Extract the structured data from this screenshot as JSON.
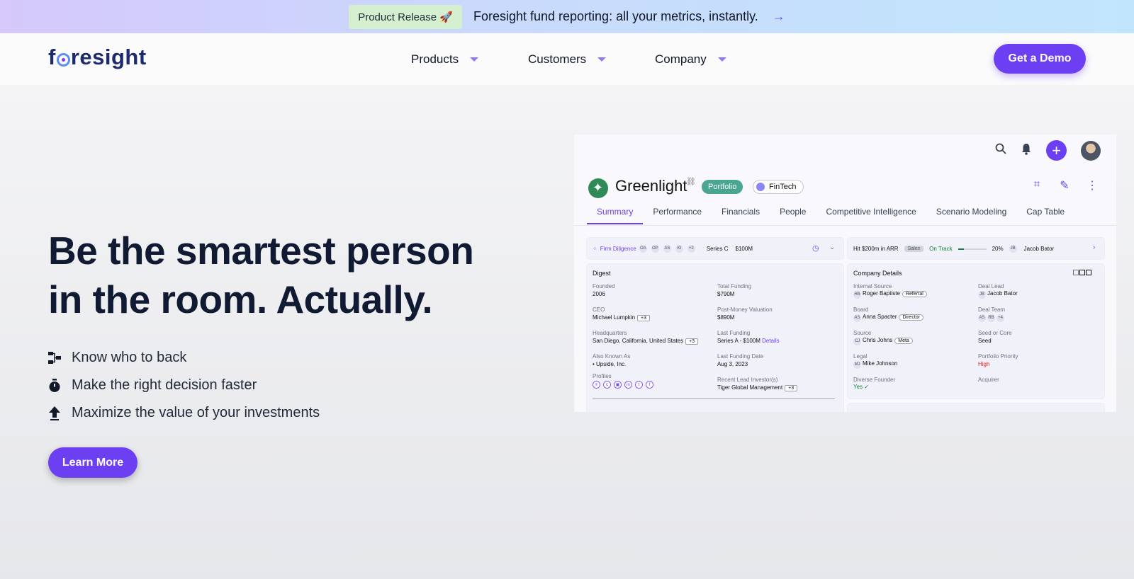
{
  "announcement": {
    "pill": "Product Release 🚀",
    "message": "Foresight fund reporting: all your metrics, instantly.",
    "arrow": "→"
  },
  "nav": {
    "logo": "foresight",
    "items": [
      {
        "label": "Products"
      },
      {
        "label": "Customers"
      },
      {
        "label": "Company"
      }
    ],
    "cta": "Get a Demo"
  },
  "hero": {
    "title_line1": "Be the smartest person",
    "title_line2": "in the room. Actually.",
    "features": [
      {
        "icon": "decision-tree-icon",
        "label": "Know who to back"
      },
      {
        "icon": "stopwatch-icon",
        "label": "Make the right decision faster"
      },
      {
        "icon": "arrow-up-icon",
        "label": "Maximize the value of your investments"
      }
    ],
    "cta": "Learn More"
  },
  "mockup": {
    "company": "Greenlight",
    "tags": {
      "portfolio": "Portfolio",
      "sector": "FinTech"
    },
    "tabs": [
      "Summary",
      "Performance",
      "Financials",
      "People",
      "Competitive Intelligence",
      "Scenario Modeling",
      "Cap Table"
    ],
    "active_tab": "Summary",
    "status_bar_left": {
      "label": "Firm Diligence",
      "initials": [
        "OA",
        "OP",
        "AS",
        "KI"
      ],
      "more": "+2",
      "series": "Series C",
      "amount": "$100M"
    },
    "status_bar_right": {
      "goal": "Hit $200m in ARR",
      "team": "Sales",
      "status": "On Track",
      "progress_percent": 20,
      "progress_label": "20%",
      "owner": "Jacob Bator",
      "owner_initials": "JB"
    },
    "digest": {
      "title": "Digest",
      "founded_label": "Founded",
      "founded": "2006",
      "ceo_label": "CEO",
      "ceo": "Michael Lumpkin",
      "ceo_more": "+3",
      "hq_label": "Headquarters",
      "hq": "San Diego, California, United States",
      "hq_more": "+3",
      "aka_label": "Also Known As",
      "aka": "• Upside, Inc.",
      "profiles_label": "Profiles",
      "total_funding_label": "Total Funding",
      "total_funding": "$790M",
      "valuation_label": "Post-Money Valuation",
      "valuation": "$890M",
      "last_funding_label": "Last Funding",
      "last_funding": "Series A - $100M",
      "last_funding_link": "Details",
      "last_funding_date_label": "Last Funding Date",
      "last_funding_date": "Aug 3, 2023",
      "lead_investor_label": "Recent Lead Investor(s)",
      "lead_investor": "Tiger Global Management",
      "lead_more": "+3"
    },
    "company_details": {
      "title": "Company Details",
      "internal_source_label": "Internal Source",
      "internal_source": "Roger Baptiste",
      "internal_source_initials": "RB",
      "internal_source_chip": "Referral",
      "board_label": "Board",
      "board": "Anna Spacter",
      "board_initials": "AS",
      "board_chip": "Director",
      "source_label": "Source",
      "source": "Chris Johns",
      "source_initials": "CJ",
      "source_chip": "Meta",
      "legal_label": "Legal",
      "legal": "Mike Johnson",
      "legal_initials": "MJ",
      "diverse_label": "Diverse Founder",
      "diverse": "Yes ✓",
      "deal_lead_label": "Deal Lead",
      "deal_lead": "Jacob Bator",
      "deal_lead_initials": "JB",
      "deal_team_label": "Deal Team",
      "deal_team_initials": [
        "AS",
        "RB"
      ],
      "deal_team_more": "+4",
      "seed_label": "Seed or Core",
      "seed": "Seed",
      "priority_label": "Portfolio Priority",
      "priority": "High",
      "acquirer_label": "Acquirer"
    }
  }
}
